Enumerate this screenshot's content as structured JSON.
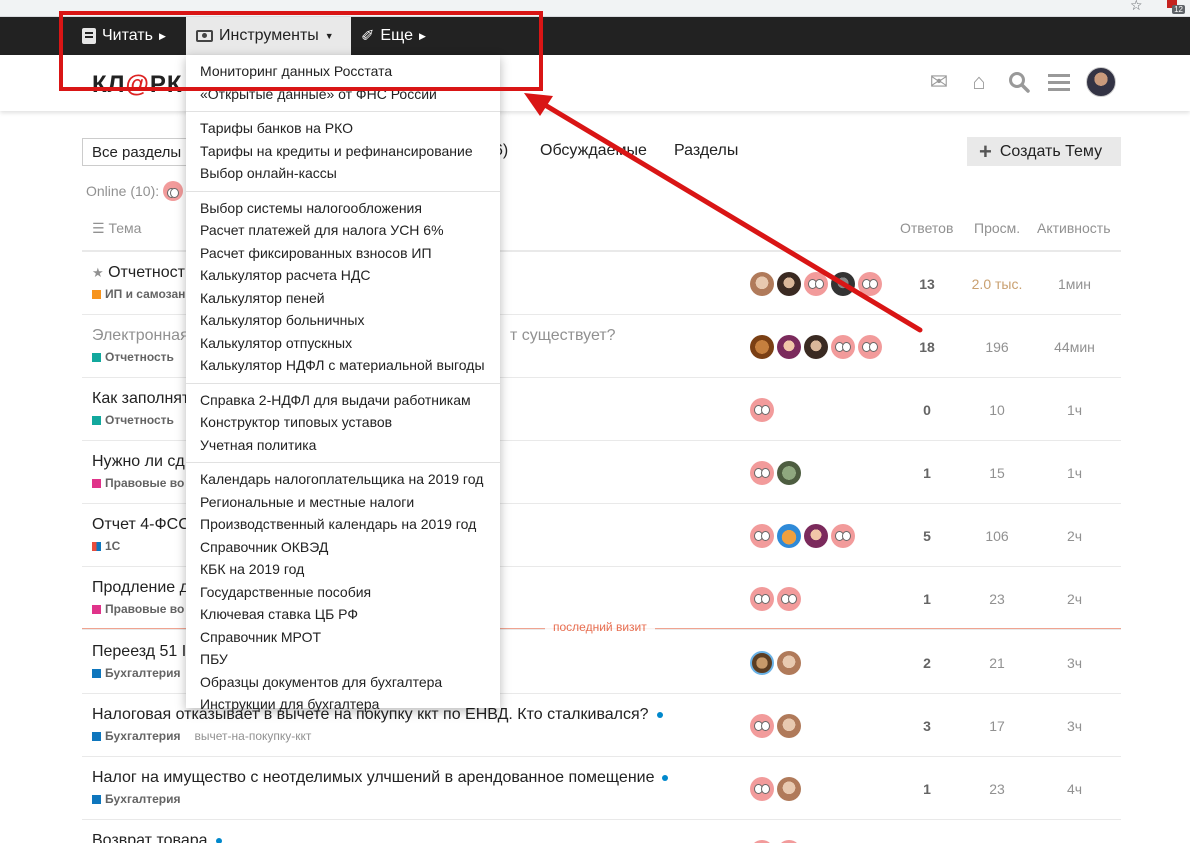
{
  "nav": {
    "read_label": "Читать",
    "tools_label": "Инструменты",
    "more_label": "Еще"
  },
  "chrome": {
    "ext_badge": "12"
  },
  "logo": {
    "text_a": "КЛ",
    "text_clip": "@",
    "text_b": "РК"
  },
  "filters": {
    "select_value": "Все разделы",
    "tab_partial": "6)",
    "tab_discussed": "Обсуждаемые",
    "tab_sections": "Разделы",
    "create_label": "Создать Тему",
    "online_label": "Online (10):"
  },
  "table_header": {
    "topic": "Тема",
    "replies": "Ответов",
    "views": "Просм.",
    "activity": "Активность"
  },
  "last_visit_label": "последний визит",
  "rows": [
    {
      "title": "Отчетност",
      "category": "ИП и самозан",
      "cat_color": "#f7941d",
      "tag": "",
      "unread_dot": false,
      "read": false,
      "replies": "13",
      "views": "2.0 тыс.",
      "activity": "1мин"
    },
    {
      "title": "Электронная",
      "title_tail": "т существует?",
      "category": "Отчетность",
      "cat_color": "#12a89d",
      "tag": "",
      "unread_dot": false,
      "read": true,
      "replies": "18",
      "views": "196",
      "activity": "44мин"
    },
    {
      "title": "Как заполнят",
      "category": "Отчетность",
      "cat_color": "#12a89d",
      "tag": "",
      "unread_dot": false,
      "read": false,
      "replies": "0",
      "views": "10",
      "activity": "1ч"
    },
    {
      "title": "Нужно ли сд",
      "category": "Правовые во",
      "cat_color": "#e0338a",
      "tag": "",
      "unread_dot": false,
      "read": false,
      "replies": "1",
      "views": "15",
      "activity": "1ч"
    },
    {
      "title": "Отчет 4-ФСС",
      "category": "1С",
      "cat_color": "#3ab54a",
      "tag": "",
      "unread_dot": false,
      "read": false,
      "replies": "5",
      "views": "106",
      "activity": "2ч"
    },
    {
      "title": "Продление д",
      "category": "Правовые во",
      "cat_color": "#e0338a",
      "tag": "",
      "unread_dot": false,
      "read": false,
      "replies": "1",
      "views": "23",
      "activity": "2ч"
    },
    {
      "title": "Переезд 51 I",
      "category": "Бухгалтерия",
      "cat_color": "#0e76bd",
      "tag": "",
      "unread_dot": false,
      "read": false,
      "replies": "2",
      "views": "21",
      "activity": "3ч"
    },
    {
      "title": "Налоговая отказывает в вычете на покупку ккт по ЕНВД. Кто сталкивался?",
      "category": "Бухгалтерия",
      "cat_color": "#0e76bd",
      "tag": "вычет-на-покупку-ккт",
      "unread_dot": true,
      "read": false,
      "replies": "3",
      "views": "17",
      "activity": "3ч"
    },
    {
      "title": "Налог на имущество с неотделимых улчшений в арендованное помещение",
      "category": "Бухгалтерия",
      "cat_color": "#0e76bd",
      "tag": "",
      "unread_dot": true,
      "read": false,
      "replies": "1",
      "views": "23",
      "activity": "4ч"
    },
    {
      "title": "Возврат товара",
      "category": "",
      "cat_color": "#0e76bd",
      "tag": "",
      "unread_dot": true,
      "read": false,
      "replies": "",
      "views": "",
      "activity": ""
    }
  ],
  "dropdown": {
    "groups": [
      [
        "Мониторинг данных Росстата",
        "«Открытые данные» от ФНС России"
      ],
      [
        "Тарифы банков на РКО",
        "Тарифы на кредиты и рефинансирование",
        "Выбор онлайн-кассы"
      ],
      [
        "Выбор системы налогообложения",
        "Расчет платежей для налога УСН 6%",
        "Расчет фиксированных взносов ИП",
        "Калькулятор расчета НДС",
        "Калькулятор пеней",
        "Калькулятор больничных",
        "Калькулятор отпускных",
        "Калькулятор НДФЛ с материальной выгоды"
      ],
      [
        "Справка 2-НДФЛ для выдачи работникам",
        "Конструктор типовых уставов",
        "Учетная политика"
      ],
      [
        "Календарь налогоплательщика на 2019 год",
        "Региональные и местные налоги",
        "Производственный календарь на 2019 год",
        "Справочник ОКВЭД",
        "КБК на 2019 год",
        "Государственные пособия",
        "Ключевая ставка ЦБ РФ",
        "Справочник МРОТ",
        "ПБУ",
        "Образцы документов для бухгалтера",
        "Инструкции для бухгалтера"
      ]
    ]
  },
  "colors": {
    "accent_annotation": "#d91515",
    "topnav_bg": "#222222",
    "last_visit": "#e45735"
  }
}
